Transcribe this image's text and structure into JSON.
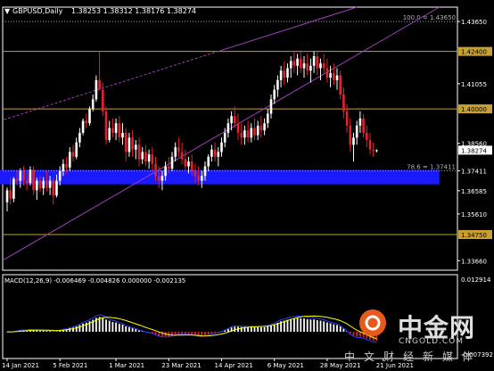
{
  "header": {
    "symbol_label": "GBPUSD,Daily",
    "ohlc_label": "1.38253 1.38312 1.38176 1.38274",
    "menu_glyph": "▼"
  },
  "macd": {
    "label": "MACD(12,26,9) -0.006469 -0.004826 0.000000 -0.002135",
    "top_tick": "0.012914",
    "bottom_tick": "-0.007392"
  },
  "watermark": {
    "logo_glyph": "◉",
    "name": "中金网",
    "site": "CNGOLD.COM",
    "subtitle": "中文财经新媒体"
  },
  "colors": {
    "background": "#000000",
    "bull": "#ffffff",
    "bear": "#e0232e",
    "level_line": "#c8a032",
    "zone": "#1a1aff",
    "channel": "#a040c0",
    "macd_signal": "#ffff00",
    "macd_line": "#2040ff"
  },
  "chart_data": {
    "type": "candlestick",
    "symbol": "GBPUSD",
    "timeframe": "Daily",
    "ylim": [
      1.3326,
      1.4425
    ],
    "y_ticks": [
      {
        "value": 1.4365,
        "label": "1.43650"
      },
      {
        "value": 1.424,
        "label": "1.42400"
      },
      {
        "value": 1.4105,
        "label": "1.41055"
      },
      {
        "value": 1.4,
        "label": "1.40000"
      },
      {
        "value": 1.3856,
        "label": "1.38560"
      },
      {
        "value": 1.38274,
        "label": "1.38274"
      },
      {
        "value": 1.3741,
        "label": "1.37411"
      },
      {
        "value": 1.3658,
        "label": "1.36585"
      },
      {
        "value": 1.3561,
        "label": "1.35610"
      },
      {
        "value": 1.3475,
        "label": "1.34750"
      },
      {
        "value": 1.3366,
        "label": "1.33660"
      }
    ],
    "x_labels": [
      "14 Jan 2021",
      "5 Feb 2021",
      "1 Mar 2021",
      "23 Mar 2021",
      "14 Apr 2021",
      "6 May 2021",
      "28 May 2021",
      "21 Jun 2021"
    ],
    "x_label_index": [
      0,
      16,
      33,
      49,
      65,
      81,
      97,
      114
    ],
    "levels": [
      {
        "value": 1.4365,
        "style": "dashed"
      },
      {
        "value": 1.424,
        "style": "solid",
        "label": "1.42400"
      },
      {
        "value": 1.4,
        "style": "solid",
        "label": "1.40000"
      },
      {
        "value": 1.3741,
        "style": "dashed"
      },
      {
        "value": 1.3475,
        "style": "solid",
        "label": "1.34750"
      }
    ],
    "fib_annotations": [
      {
        "value": 1.4365,
        "text": "100.0 = 1.43650"
      },
      {
        "value": 1.3741,
        "text": "78.6 = 1.37411"
      }
    ],
    "zone": {
      "from": 1.3685,
      "to": 1.3745,
      "start_index": 0,
      "end_index": 131
    },
    "channel": {
      "lower": [
        [
          -1,
          1.337
        ],
        [
          131,
          1.4425
        ]
      ],
      "upper": [
        [
          -1,
          1.3955
        ],
        [
          106,
          1.4425
        ]
      ],
      "upper_style": "dashed-then-solid"
    },
    "current_price": 1.38274,
    "candles": [
      [
        1.361,
        1.3672,
        1.3572,
        1.366
      ],
      [
        1.366,
        1.3715,
        1.36,
        1.3625
      ],
      [
        1.3625,
        1.3715,
        1.361,
        1.3708
      ],
      [
        1.3708,
        1.3746,
        1.368,
        1.37
      ],
      [
        1.37,
        1.3752,
        1.367,
        1.374
      ],
      [
        1.374,
        1.376,
        1.368,
        1.3702
      ],
      [
        1.3702,
        1.3735,
        1.366,
        1.369
      ],
      [
        1.369,
        1.376,
        1.368,
        1.3746
      ],
      [
        1.3746,
        1.376,
        1.364,
        1.366
      ],
      [
        1.366,
        1.3712,
        1.362,
        1.37
      ],
      [
        1.37,
        1.372,
        1.3652,
        1.3668
      ],
      [
        1.3668,
        1.3715,
        1.364,
        1.37
      ],
      [
        1.37,
        1.374,
        1.3655,
        1.367
      ],
      [
        1.367,
        1.372,
        1.364,
        1.37
      ],
      [
        1.37,
        1.3712,
        1.36,
        1.3638
      ],
      [
        1.3638,
        1.3725,
        1.363,
        1.37
      ],
      [
        1.37,
        1.376,
        1.368,
        1.374
      ],
      [
        1.374,
        1.379,
        1.372,
        1.377
      ],
      [
        1.377,
        1.38,
        1.373,
        1.3755
      ],
      [
        1.3755,
        1.384,
        1.374,
        1.382
      ],
      [
        1.382,
        1.385,
        1.378,
        1.38
      ],
      [
        1.38,
        1.388,
        1.379,
        1.386
      ],
      [
        1.386,
        1.392,
        1.384,
        1.39
      ],
      [
        1.39,
        1.396,
        1.389,
        1.395
      ],
      [
        1.395,
        1.398,
        1.392,
        1.394
      ],
      [
        1.394,
        1.401,
        1.393,
        1.4
      ],
      [
        1.4,
        1.406,
        1.399,
        1.404
      ],
      [
        1.404,
        1.414,
        1.403,
        1.412
      ],
      [
        1.412,
        1.424,
        1.41,
        1.408
      ],
      [
        1.408,
        1.411,
        1.397,
        1.399
      ],
      [
        1.399,
        1.401,
        1.385,
        1.387
      ],
      [
        1.387,
        1.395,
        1.386,
        1.392
      ],
      [
        1.392,
        1.396,
        1.388,
        1.39
      ],
      [
        1.39,
        1.396,
        1.387,
        1.394
      ],
      [
        1.394,
        1.397,
        1.386,
        1.388
      ],
      [
        1.388,
        1.394,
        1.385,
        1.39
      ],
      [
        1.39,
        1.392,
        1.378,
        1.382
      ],
      [
        1.382,
        1.39,
        1.38,
        1.388
      ],
      [
        1.388,
        1.391,
        1.38,
        1.383
      ],
      [
        1.383,
        1.387,
        1.379,
        1.385
      ],
      [
        1.385,
        1.388,
        1.376,
        1.379
      ],
      [
        1.379,
        1.384,
        1.377,
        1.382
      ],
      [
        1.382,
        1.385,
        1.376,
        1.378
      ],
      [
        1.378,
        1.383,
        1.375,
        1.381
      ],
      [
        1.381,
        1.384,
        1.374,
        1.377
      ],
      [
        1.377,
        1.38,
        1.37,
        1.372
      ],
      [
        1.372,
        1.376,
        1.367,
        1.37
      ],
      [
        1.37,
        1.374,
        1.366,
        1.372
      ],
      [
        1.372,
        1.378,
        1.37,
        1.376
      ],
      [
        1.376,
        1.38,
        1.373,
        1.375
      ],
      [
        1.375,
        1.382,
        1.374,
        1.38
      ],
      [
        1.38,
        1.386,
        1.378,
        1.384
      ],
      [
        1.384,
        1.388,
        1.38,
        1.382
      ],
      [
        1.382,
        1.386,
        1.377,
        1.379
      ],
      [
        1.379,
        1.383,
        1.374,
        1.376
      ],
      [
        1.376,
        1.38,
        1.373,
        1.378
      ],
      [
        1.378,
        1.381,
        1.372,
        1.374
      ],
      [
        1.374,
        1.377,
        1.369,
        1.372
      ],
      [
        1.372,
        1.376,
        1.368,
        1.37
      ],
      [
        1.37,
        1.374,
        1.367,
        1.372
      ],
      [
        1.372,
        1.378,
        1.37,
        1.376
      ],
      [
        1.376,
        1.381,
        1.374,
        1.38
      ],
      [
        1.38,
        1.385,
        1.378,
        1.383
      ],
      [
        1.383,
        1.386,
        1.378,
        1.38
      ],
      [
        1.38,
        1.384,
        1.376,
        1.382
      ],
      [
        1.382,
        1.388,
        1.38,
        1.386
      ],
      [
        1.386,
        1.392,
        1.384,
        1.39
      ],
      [
        1.39,
        1.396,
        1.388,
        1.394
      ],
      [
        1.394,
        1.399,
        1.391,
        1.397
      ],
      [
        1.397,
        1.401,
        1.392,
        1.394
      ],
      [
        1.394,
        1.398,
        1.387,
        1.39
      ],
      [
        1.39,
        1.394,
        1.385,
        1.388
      ],
      [
        1.388,
        1.393,
        1.385,
        1.391
      ],
      [
        1.391,
        1.395,
        1.386,
        1.388
      ],
      [
        1.388,
        1.394,
        1.386,
        1.392
      ],
      [
        1.392,
        1.396,
        1.387,
        1.389
      ],
      [
        1.389,
        1.395,
        1.387,
        1.393
      ],
      [
        1.393,
        1.397,
        1.388,
        1.391
      ],
      [
        1.391,
        1.396,
        1.389,
        1.394
      ],
      [
        1.394,
        1.4,
        1.392,
        1.398
      ],
      [
        1.398,
        1.406,
        1.396,
        1.404
      ],
      [
        1.404,
        1.41,
        1.402,
        1.408
      ],
      [
        1.408,
        1.414,
        1.405,
        1.412
      ],
      [
        1.412,
        1.418,
        1.409,
        1.416
      ],
      [
        1.416,
        1.42,
        1.41,
        1.413
      ],
      [
        1.413,
        1.419,
        1.411,
        1.417
      ],
      [
        1.417,
        1.422,
        1.413,
        1.42
      ],
      [
        1.42,
        1.424,
        1.415,
        1.418
      ],
      [
        1.418,
        1.423,
        1.414,
        1.421
      ],
      [
        1.421,
        1.4245,
        1.415,
        1.417
      ],
      [
        1.417,
        1.422,
        1.413,
        1.419
      ],
      [
        1.419,
        1.423,
        1.414,
        1.416
      ],
      [
        1.416,
        1.421,
        1.411,
        1.418
      ],
      [
        1.418,
        1.424,
        1.415,
        1.422
      ],
      [
        1.422,
        1.4245,
        1.414,
        1.417
      ],
      [
        1.417,
        1.421,
        1.412,
        1.419
      ],
      [
        1.419,
        1.423,
        1.415,
        1.417
      ],
      [
        1.417,
        1.421,
        1.411,
        1.413
      ],
      [
        1.413,
        1.418,
        1.409,
        1.415
      ],
      [
        1.415,
        1.419,
        1.41,
        1.412
      ],
      [
        1.412,
        1.417,
        1.408,
        1.414
      ],
      [
        1.414,
        1.416,
        1.404,
        1.406
      ],
      [
        1.406,
        1.409,
        1.396,
        1.399
      ],
      [
        1.399,
        1.402,
        1.39,
        1.393
      ],
      [
        1.393,
        1.396,
        1.382,
        1.385
      ],
      [
        1.385,
        1.39,
        1.378,
        1.388
      ],
      [
        1.388,
        1.395,
        1.385,
        1.393
      ],
      [
        1.393,
        1.399,
        1.39,
        1.396
      ],
      [
        1.396,
        1.398,
        1.388,
        1.39
      ],
      [
        1.39,
        1.393,
        1.384,
        1.387
      ],
      [
        1.387,
        1.39,
        1.381,
        1.383
      ],
      [
        1.383,
        1.386,
        1.38,
        1.3825
      ],
      [
        1.3825,
        1.3831,
        1.3818,
        1.38274
      ]
    ]
  }
}
